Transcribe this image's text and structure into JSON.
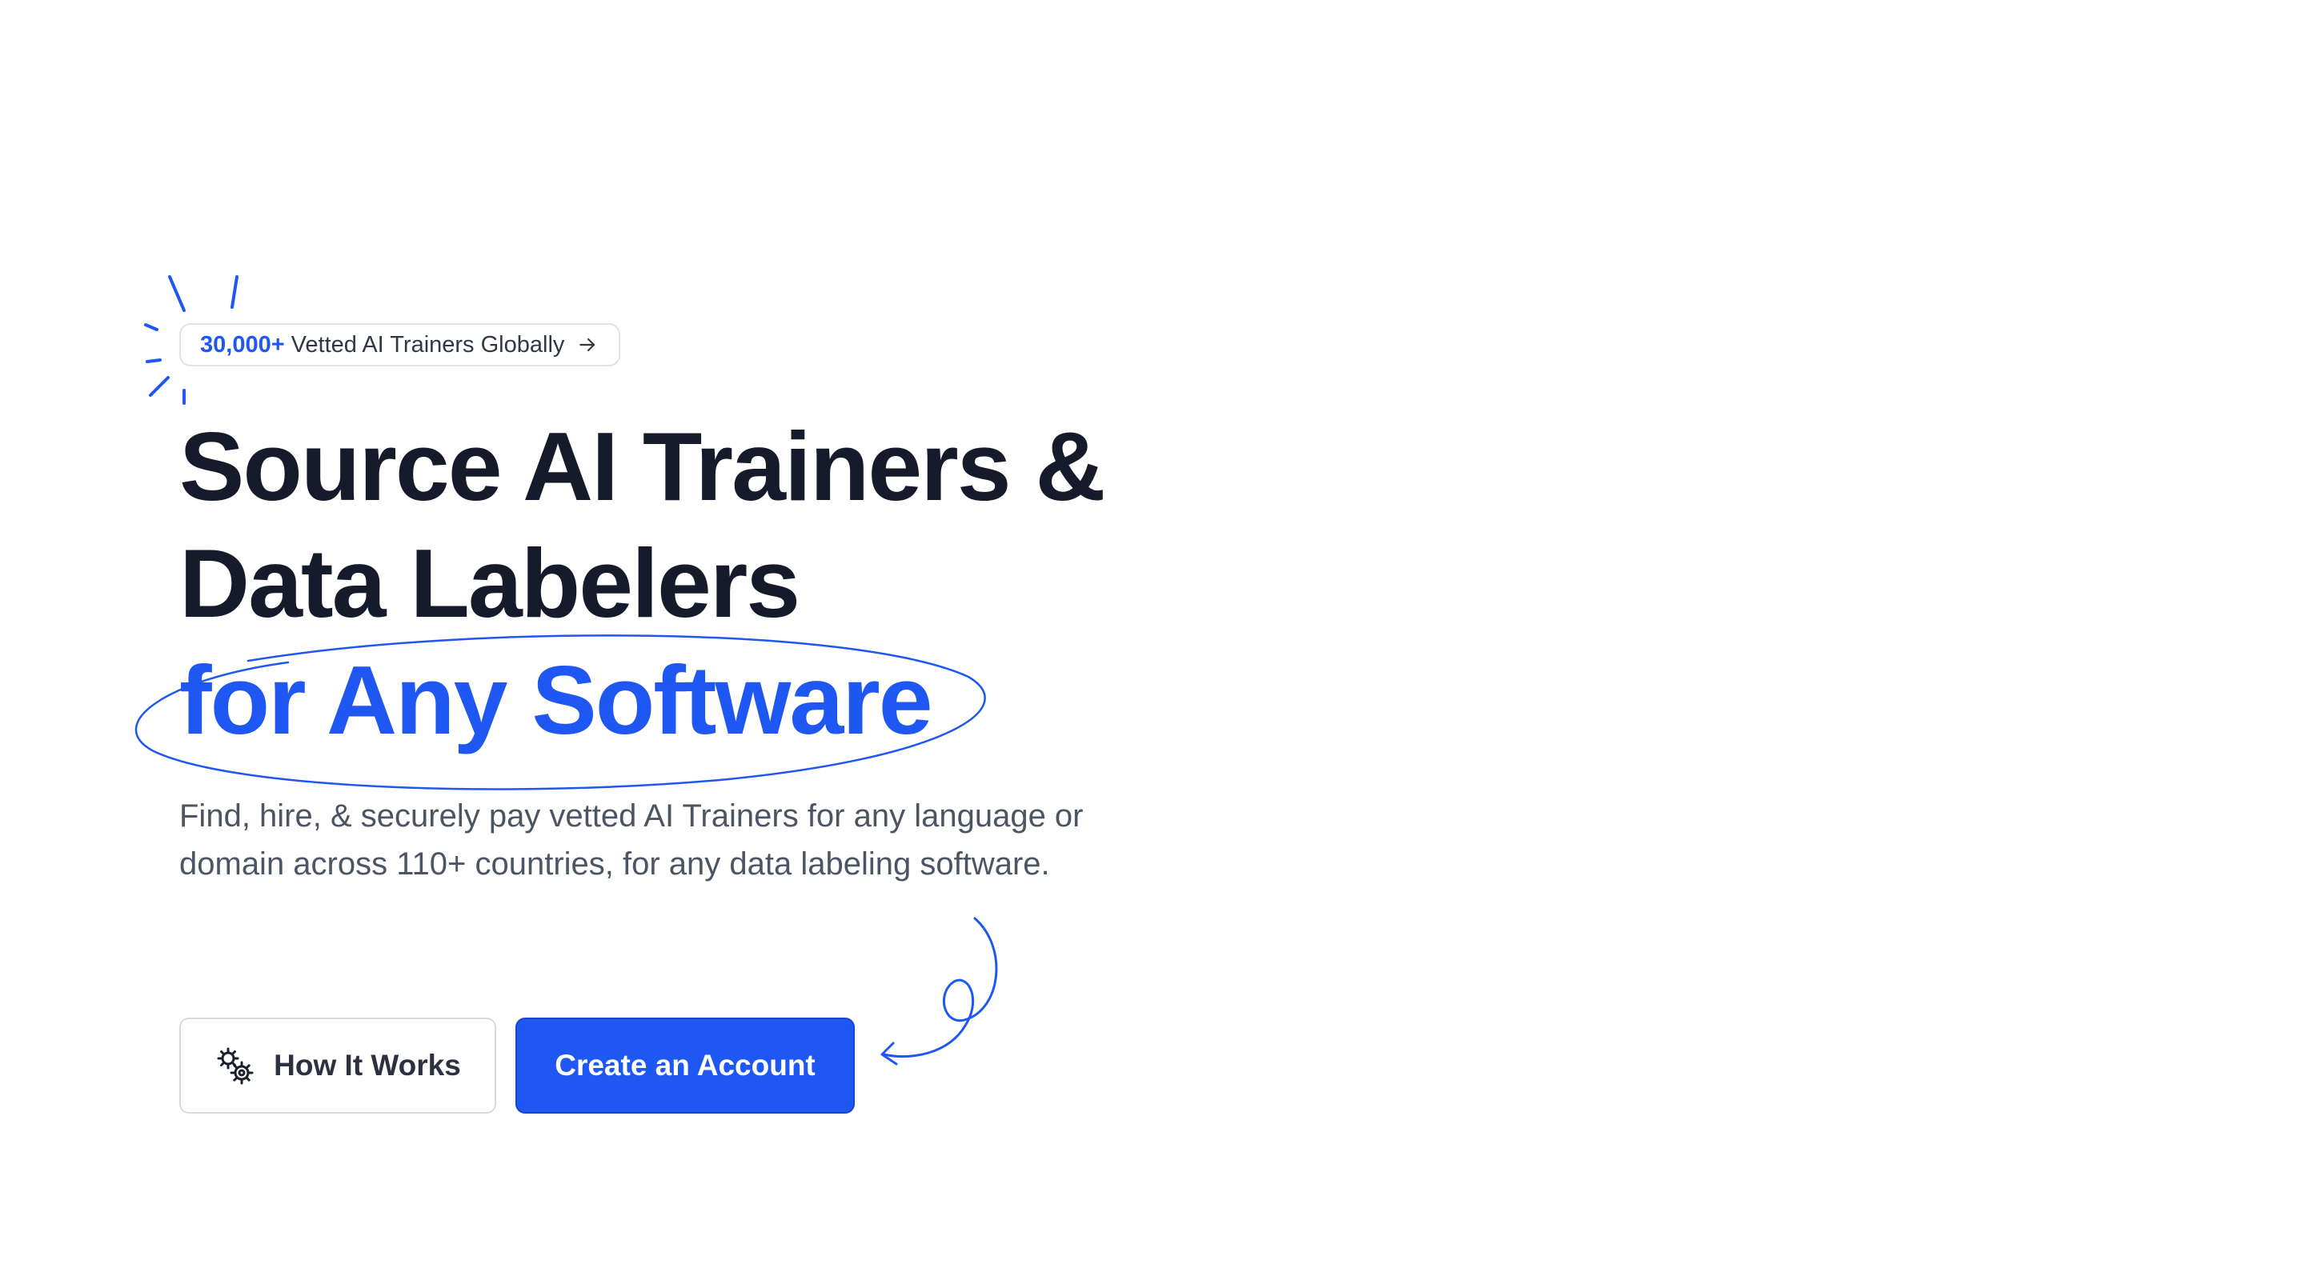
{
  "hero": {
    "badge": {
      "count": "30,000+",
      "text": "Vetted AI Trainers Globally",
      "arrow_icon": "arrow-right-icon"
    },
    "headline": {
      "line1": "Source AI Trainers &",
      "line2": "Data Labelers",
      "accent": "for Any Software"
    },
    "subtext": "Find, hire, & securely pay vetted AI Trainers for any language or domain across 110+ countries, for any data labeling software.",
    "buttons": {
      "how_it_works": "How It Works",
      "how_it_works_icon": "gears-icon",
      "create_account": "Create an Account"
    }
  },
  "colors": {
    "accent": "#1f57f2",
    "heading": "#151b2b",
    "body_text": "#4b5563",
    "background": "#ffffff"
  }
}
